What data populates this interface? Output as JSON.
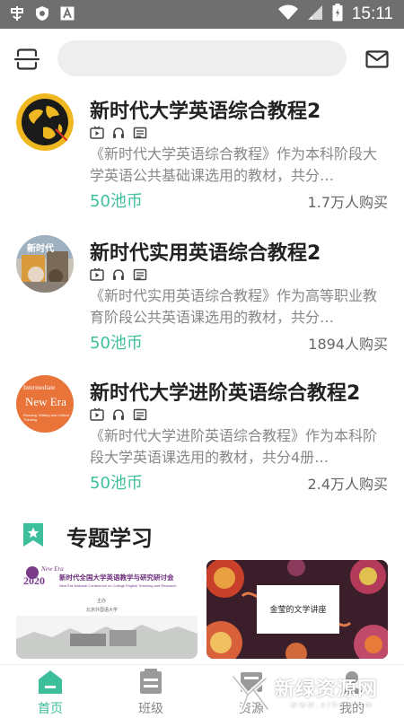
{
  "status_bar": {
    "time": "15:11"
  },
  "search": {
    "placeholder": ""
  },
  "courses": [
    {
      "title": "新时代大学英语综合教程2",
      "desc": "《新时代大学英语综合教程》作为本科阶段大学英语公共基础课选用的教材，共分…",
      "price": "50池币",
      "buyers": "1.7万人购买"
    },
    {
      "title": "新时代实用英语综合教程2",
      "desc": "《新时代实用英语综合教程》作为高等职业教育阶段公共英语课选用的教材，共分…",
      "price": "50池币",
      "buyers": "1894人购买"
    },
    {
      "title": "新时代大学进阶英语综合教程2",
      "desc": "《新时代大学进阶英语综合教程》作为本科阶段大学英语课选用的教材，共分4册…",
      "price": "50池币",
      "buyers": "2.4万人购买"
    }
  ],
  "thumbs": {
    "t2_text": "新时代",
    "t3_line1": "Intermediate",
    "t3_line2": "New Era",
    "t3_line3": "Reading, Writing and Critical Thinking"
  },
  "topic": {
    "title": "专题学习"
  },
  "banners": {
    "b1_year": "2020",
    "b1_brand": "New Era",
    "b1_title": "新时代全国大学英语教学与研究研讨会",
    "b1_sub": "New Era National Conference on College English Teaching and Research",
    "b1_host1": "主办",
    "b1_host2": "北京外国语大学",
    "b2_title": "金莹的文学讲座"
  },
  "nav": [
    {
      "label": "首页"
    },
    {
      "label": "班级"
    },
    {
      "label": "资源"
    },
    {
      "label": "我的"
    }
  ],
  "watermark": {
    "text": "新绿资源网",
    "url": "www.xlhs.com"
  },
  "colors": {
    "accent": "#3dbf9c",
    "statusbar": "#6f6f6f"
  }
}
